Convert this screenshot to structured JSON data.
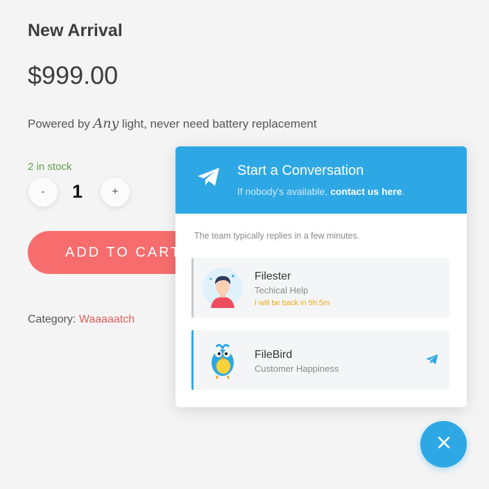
{
  "product": {
    "title": "New Arrival",
    "price": "$999.00",
    "description_before": "Powered by ",
    "description_emphasis": "Any",
    "description_after": " light, never need battery replacement",
    "stock": "2 in stock",
    "quantity": "1",
    "qty_minus_label": "-",
    "qty_plus_label": "+",
    "add_to_cart_label": "ADD TO CART",
    "category_label": "Category: ",
    "category_value": "Waaaaatch"
  },
  "chat": {
    "title": "Start a Conversation",
    "subtitle_before": "If nobody's available, ",
    "subtitle_link": "contact us here",
    "subtitle_after": ".",
    "reply_note": "The team typically replies in a few minutes.",
    "agents": [
      {
        "name": "Filester",
        "role": "Techical Help",
        "status": "I will be back in 5h:5m",
        "icon": "person-avatar"
      },
      {
        "name": "FileBird",
        "role": "Customer Happiness",
        "icon": "bird-avatar"
      }
    ]
  },
  "colors": {
    "accent": "#2ea8e5",
    "cart_button": "#f76d6e",
    "stock_text": "#5ea14a",
    "away_text": "#f0a81a",
    "category_link": "#e35b5b"
  },
  "icons": {
    "header": "telegram-plane-icon",
    "agent_send": "telegram-plane-icon",
    "fab": "close-icon"
  }
}
